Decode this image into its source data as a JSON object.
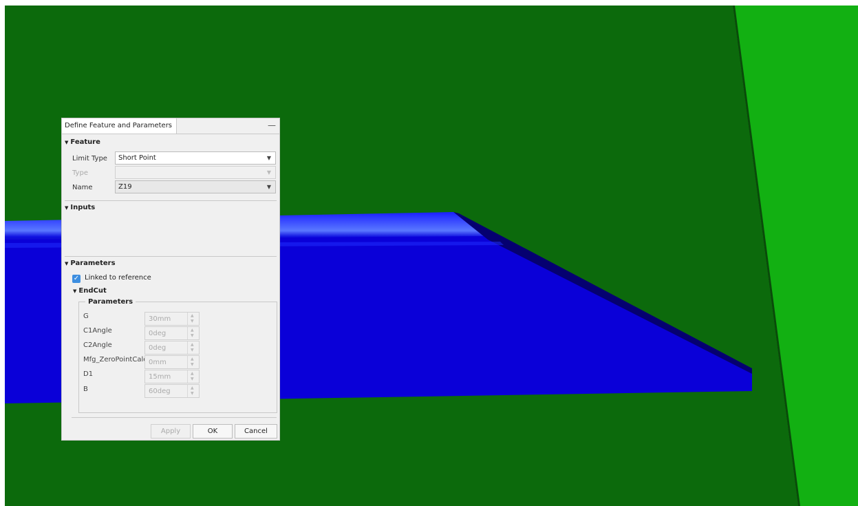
{
  "colors": {
    "background_dark_green": "#0c6a0c",
    "background_bright_green": "#12b012",
    "part_blue": "#0a00d8",
    "checkbox_blue": "#3d8ee0"
  },
  "dialog": {
    "title": "Define Feature and Parameters",
    "minimize_icon": "minimize-icon",
    "feature_section": {
      "header": "Feature",
      "limit_type": {
        "label": "Limit Type",
        "value": "Short Point"
      },
      "type": {
        "label": "Type",
        "value": ""
      },
      "name": {
        "label": "Name",
        "value": "Z19"
      }
    },
    "inputs_section": {
      "header": "Inputs"
    },
    "parameters_section": {
      "header": "Parameters",
      "linked_checkbox": {
        "label": "Linked to reference",
        "checked": true
      },
      "endcut": {
        "header": "EndCut",
        "group_title": "Parameters",
        "params": [
          {
            "label": "G",
            "value": "30mm"
          },
          {
            "label": "C1Angle",
            "value": "0deg"
          },
          {
            "label": "C2Angle",
            "value": "0deg"
          },
          {
            "label": "Mfg_ZeroPointCalc",
            "value": "0mm"
          },
          {
            "label": "D1",
            "value": "15mm"
          },
          {
            "label": "B",
            "value": "60deg"
          }
        ]
      }
    },
    "buttons": {
      "apply": "Apply",
      "ok": "OK",
      "cancel": "Cancel"
    }
  }
}
